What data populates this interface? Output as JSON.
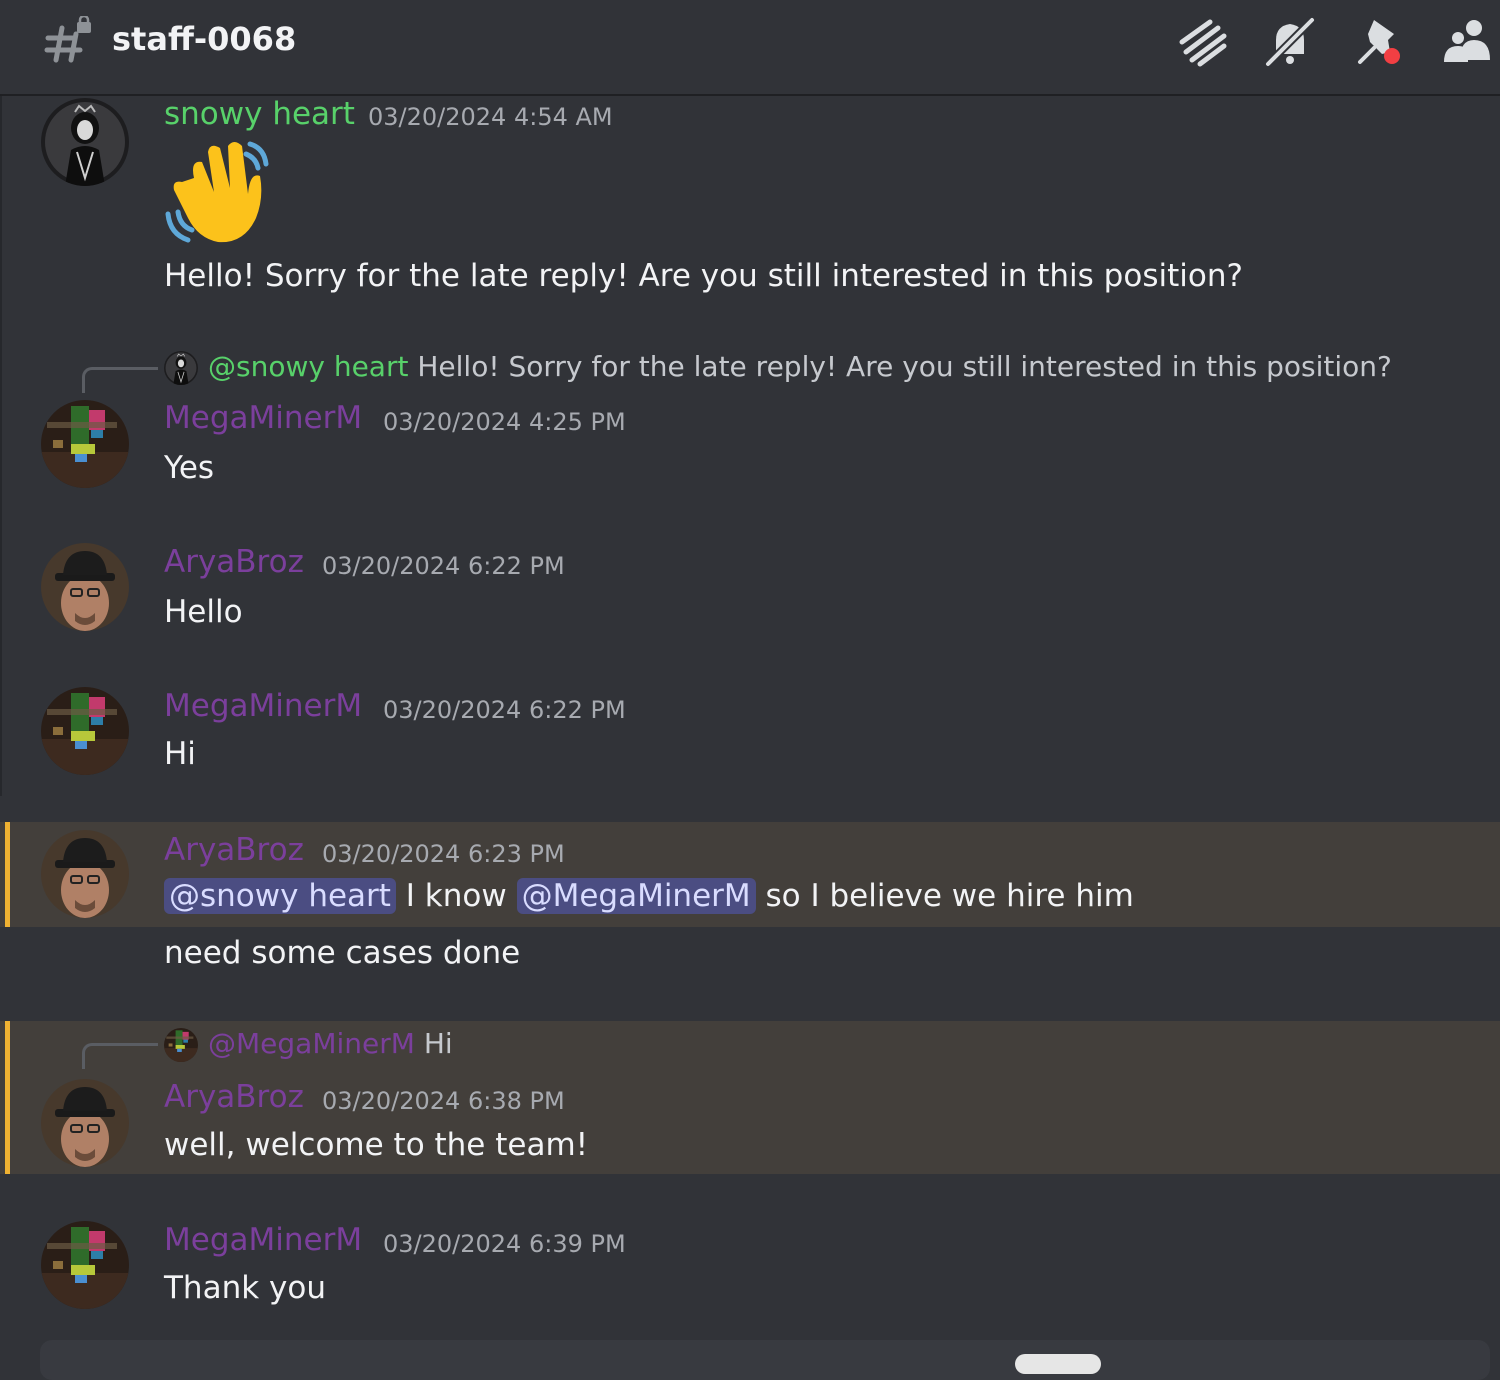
{
  "channel": {
    "name": "staff-0068"
  },
  "header_icons": [
    "threads-icon",
    "notification-muted-icon",
    "pinned-messages-icon",
    "member-list-icon"
  ],
  "colors": {
    "background": "#313338",
    "snowy_name": "#58d16a",
    "member_name": "#7b3f9c",
    "highlight": "#433f3b",
    "highlight_bar": "#f0b232",
    "mention_bg": "#4b4d82"
  },
  "messages": [
    {
      "author": "snowy heart",
      "timestamp": "03/20/2024 4:54 AM",
      "emoji": "waving-hand",
      "text": "Hello! Sorry for the late reply! Are you still interested in this position?"
    },
    {
      "reply": {
        "mention": "@snowy heart",
        "text": "Hello! Sorry for the late reply! Are you still interested in this position?"
      },
      "author": "MegaMinerM",
      "timestamp": "03/20/2024 4:25 PM",
      "text": "Yes"
    },
    {
      "author": "AryaBroz",
      "timestamp": "03/20/2024 6:22 PM",
      "text": "Hello"
    },
    {
      "author": "MegaMinerM",
      "timestamp": "03/20/2024 6:22 PM",
      "text": "Hi"
    },
    {
      "author": "AryaBroz",
      "timestamp": "03/20/2024 6:23 PM",
      "mention1": "@snowy heart",
      "text_part1": "I know",
      "mention2": "@MegaMinerM",
      "text_part2": "so I believe we hire him",
      "followup": "need some cases done"
    },
    {
      "reply": {
        "mention": "@MegaMinerM",
        "text": "Hi"
      },
      "author": "AryaBroz",
      "timestamp": "03/20/2024 6:38 PM",
      "text": "well, welcome to the team!"
    },
    {
      "author": "MegaMinerM",
      "timestamp": "03/20/2024 6:39 PM",
      "text": "Thank you"
    }
  ]
}
